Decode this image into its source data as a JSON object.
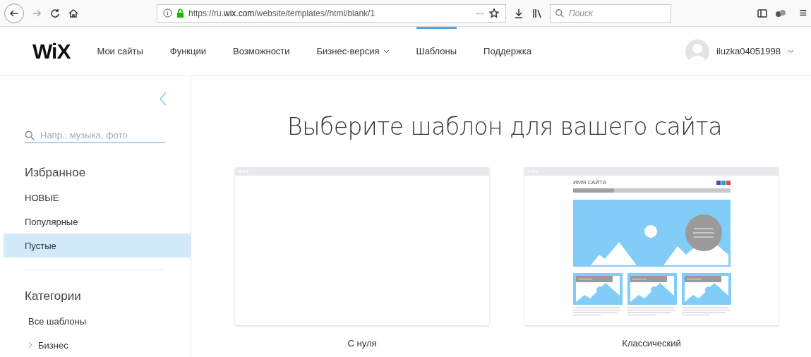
{
  "browser": {
    "url": "https://ru.**wix.com**/website/templates//html/blank/1",
    "page_actions": "···",
    "search_placeholder": "Поиск",
    "menu": "≡"
  },
  "nav": {
    "logo": "WiX",
    "items": [
      {
        "label": "Мои сайты",
        "selected": false,
        "has_menu": false
      },
      {
        "label": "Функции",
        "selected": false,
        "has_menu": false
      },
      {
        "label": "Возможности",
        "selected": false,
        "has_menu": false
      },
      {
        "label": "Бизнес-версия",
        "selected": false,
        "has_menu": true
      },
      {
        "label": "Шаблоны",
        "selected": true,
        "has_menu": false
      },
      {
        "label": "Поддержка",
        "selected": false,
        "has_menu": false
      }
    ],
    "user": {
      "name": "iluzka04051998"
    }
  },
  "sidebar": {
    "search": {
      "placeholder": "Напр.: музыка, фото"
    },
    "sections": [
      {
        "title": "Избранное",
        "items": [
          {
            "label": "НОВЫЕ",
            "selected": false,
            "expandable": false
          },
          {
            "label": "Популярные",
            "selected": false,
            "expandable": false
          },
          {
            "label": "Пустые",
            "selected": true,
            "expandable": false
          }
        ]
      },
      {
        "title": "Категории",
        "items": [
          {
            "label": "Все шаблоны",
            "selected": false,
            "expandable": false
          },
          {
            "label": "Бизнес",
            "selected": false,
            "expandable": true
          }
        ]
      }
    ]
  },
  "main": {
    "title": "Выберите шаблон для вашего сайта",
    "templates": [
      {
        "kind": "blank",
        "name": "С нуля"
      },
      {
        "kind": "classic",
        "name": "Классический",
        "preview": {
          "site_name": "ИМЯ САЙТА"
        }
      }
    ]
  }
}
